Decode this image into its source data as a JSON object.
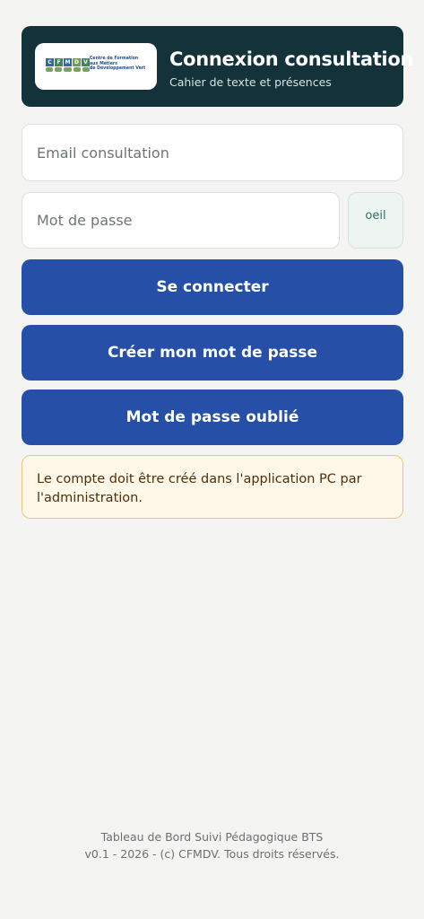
{
  "header": {
    "logo": {
      "letters": [
        "C",
        "F",
        "M",
        "D",
        "V"
      ],
      "letter_colors": [
        "#2d6aa0",
        "#3b8a5a",
        "#2d6aa0",
        "#6aa14a",
        "#3b8a5a"
      ],
      "text": "Centre de Formation\naux Métiers\nde Développement Vert"
    },
    "title": "Connexion consultation",
    "subtitle": "Cahier de texte et présences"
  },
  "form": {
    "email_placeholder": "Email consultation",
    "password_placeholder": "Mot de passe",
    "toggle_label": "oeil",
    "login_label": "Se connecter",
    "create_label": "Créer mon mot de passe",
    "forgot_label": "Mot de passe oublié"
  },
  "notice": {
    "text": "Le compte doit être créé dans l'application PC par l'administration."
  },
  "footer": {
    "line1": "Tableau de Bord Suivi Pédagogique BTS",
    "line2": "v0.1 - 2026 - (c) CFMDV. Tous droits réservés."
  },
  "colors": {
    "header_bg": "#133239",
    "primary_button": "#2650a8",
    "notice_bg": "#fff8e8",
    "notice_border": "#ecc678",
    "toggle_text": "#2b7265"
  }
}
